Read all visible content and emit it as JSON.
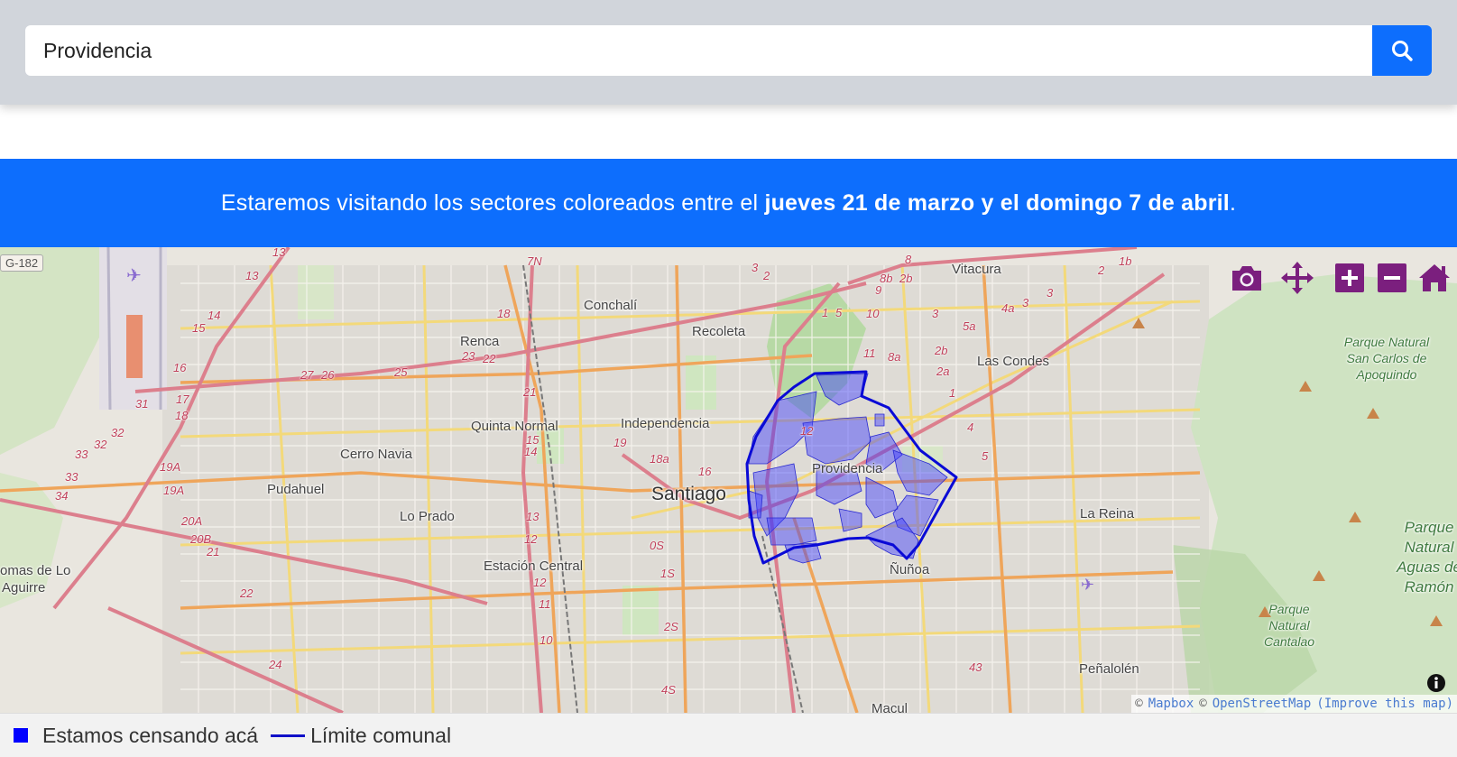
{
  "search": {
    "value": "Providencia",
    "placeholder": ""
  },
  "banner": {
    "text_prefix": "Estaremos visitando los sectores coloreados entre el ",
    "text_bold": "jueves 21 de marzo y el domingo 7 de abril",
    "text_suffix": "."
  },
  "map": {
    "highlighted_comuna": "Providencia",
    "labels": {
      "city": "Santiago",
      "comunas": [
        "Vitacura",
        "Conchalí",
        "Recoleta",
        "Renca",
        "Las Condes",
        "Quinta Normal",
        "Independencia",
        "Cerro Navia",
        "Pudahuel",
        "Lo Prado",
        "Providencia",
        "La Reina",
        "Estación Central",
        "Ñuñoa",
        "Peñalolén",
        "Macul"
      ],
      "partial": [
        "omas de Lo",
        "Aguirre"
      ],
      "parks": [
        "Parque Natural San Carlos de Apoquindo",
        "Parque Natural Aguas de Ramón",
        "Parque Natural Cantalao"
      ],
      "route_shield": "G-182",
      "road_numbers": [
        "13",
        "13",
        "14",
        "15",
        "16",
        "17",
        "18",
        "31",
        "32",
        "32",
        "33",
        "33",
        "34",
        "19A",
        "19A",
        "20A",
        "20B",
        "21",
        "22",
        "24",
        "25",
        "26",
        "27",
        "23",
        "22",
        "18",
        "21",
        "15",
        "14",
        "13",
        "12",
        "12",
        "11",
        "10",
        "7N",
        "3",
        "2",
        "1",
        "5",
        "10",
        "9",
        "8",
        "8b",
        "2b",
        "11",
        "8a",
        "2b",
        "2a",
        "3",
        "5a",
        "4a",
        "3",
        "3",
        "1b",
        "2",
        "1",
        "4",
        "5",
        "19",
        "18a",
        "16",
        "0S",
        "1S",
        "2S",
        "4S",
        "43",
        "12"
      ]
    },
    "controls": [
      "camera-icon",
      "pan-icon",
      "zoom-in-icon",
      "zoom-out-icon",
      "home-icon"
    ],
    "attribution": {
      "prefix": "©",
      "mapbox": "Mapbox",
      "sep": "©",
      "osm": "OpenStreetMap",
      "improve": "(Improve this map)"
    },
    "colors": {
      "fill": "#3b3bff",
      "boundary": "#0a0ad6",
      "controls": "#7b1f7e"
    }
  },
  "legend": {
    "censando_label": "Estamos censando acá",
    "limite_label": "Límite comunal",
    "censando_color": "#0000ff",
    "limite_color": "#1010c8"
  }
}
